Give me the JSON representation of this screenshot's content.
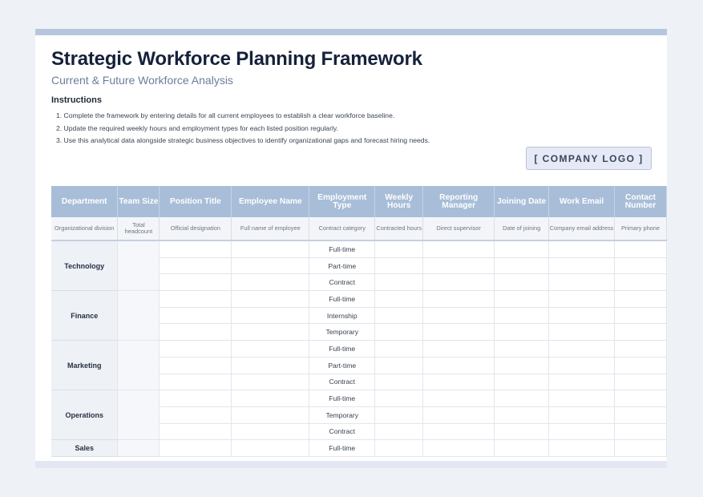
{
  "title": "Strategic Workforce Planning Framework",
  "subtitle": "Current & Future Workforce Analysis",
  "instructions": {
    "heading": "Instructions",
    "items": [
      "1.  Complete the framework by entering details for all current employees to establish a clear workforce baseline.",
      "2.  Update the required weekly hours and employment types for each listed position regularly.",
      "3.  Use this analytical data alongside strategic business objectives to identify organizational gaps and forecast hiring needs."
    ]
  },
  "logo_text": "[ COMPANY LOGO ]",
  "columns": [
    {
      "header": "Department",
      "subheader": "Organizational division"
    },
    {
      "header": "Team Size",
      "subheader": "Total headcount"
    },
    {
      "header": "Position Title",
      "subheader": "Official designation"
    },
    {
      "header": "Employee Name",
      "subheader": "Full name of employee"
    },
    {
      "header": "Employment Type",
      "subheader": "Contract category"
    },
    {
      "header": "Weekly Hours",
      "subheader": "Contracted hours"
    },
    {
      "header": "Reporting Manager",
      "subheader": "Direct supervisor"
    },
    {
      "header": "Joining Date",
      "subheader": "Date of joining"
    },
    {
      "header": "Work Email",
      "subheader": "Company email address"
    },
    {
      "header": "Contact Number",
      "subheader": "Primary phone"
    }
  ],
  "departments": [
    {
      "name": "Technology",
      "types": [
        "Full-time",
        "Part-time",
        "Contract"
      ]
    },
    {
      "name": "Finance",
      "types": [
        "Full-time",
        "Internship",
        "Temporary"
      ]
    },
    {
      "name": "Marketing",
      "types": [
        "Full-time",
        "Part-time",
        "Contract"
      ]
    },
    {
      "name": "Operations",
      "types": [
        "Full-time",
        "Temporary",
        "Contract"
      ]
    },
    {
      "name": "Sales",
      "types": [
        "Full-time"
      ]
    }
  ],
  "colors": {
    "header_bg": "#a8bdd8",
    "top_band": "#b4c7de",
    "title": "#16213a",
    "subtitle": "#6b7e99"
  }
}
